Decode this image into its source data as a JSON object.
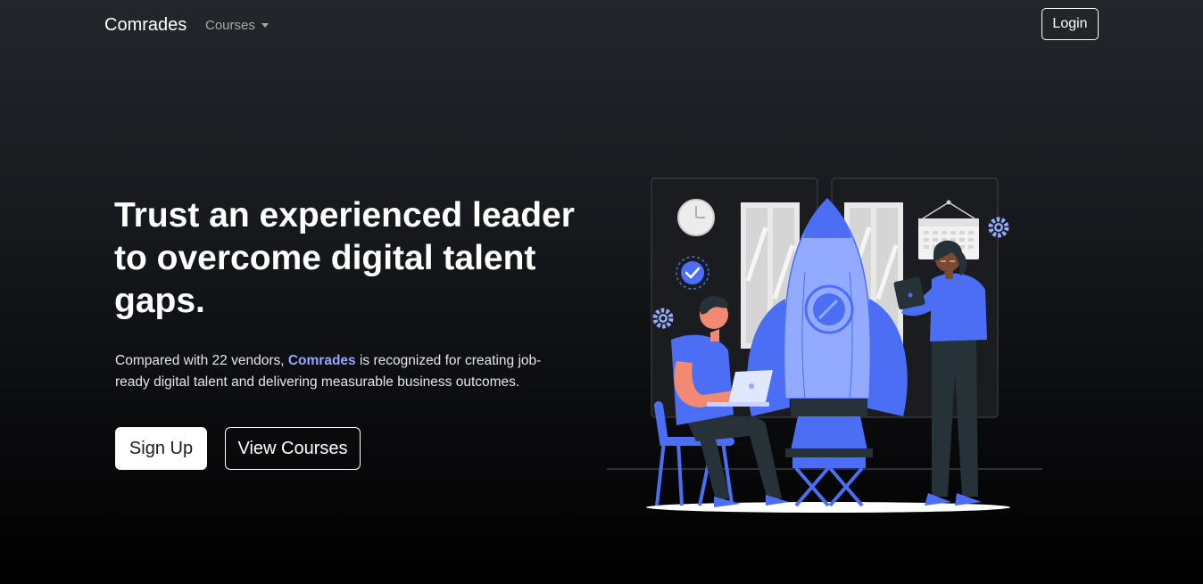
{
  "navbar": {
    "brand": "Comrades",
    "courses_label": "Courses",
    "login_label": "Login"
  },
  "hero": {
    "title": "Trust an experienced leader to overcome digital talent gaps.",
    "description_prefix": "Compared with 22 vendors, ",
    "description_brand": "Comrades",
    "description_suffix": " is recognized for creating job-ready digital talent and delivering measurable business outcomes.",
    "signup_label": "Sign Up",
    "view_courses_label": "View Courses"
  },
  "colors": {
    "accent": "#9aa4ff",
    "illustration_blue": "#4b6ef5",
    "illustration_light_blue": "#92aaff"
  },
  "icons": [
    "caret-down-icon",
    "clock-icon",
    "check-badge-icon",
    "gear-icon",
    "calendar-icon",
    "rocket-icon",
    "laptop-icon",
    "tablet-icon"
  ]
}
